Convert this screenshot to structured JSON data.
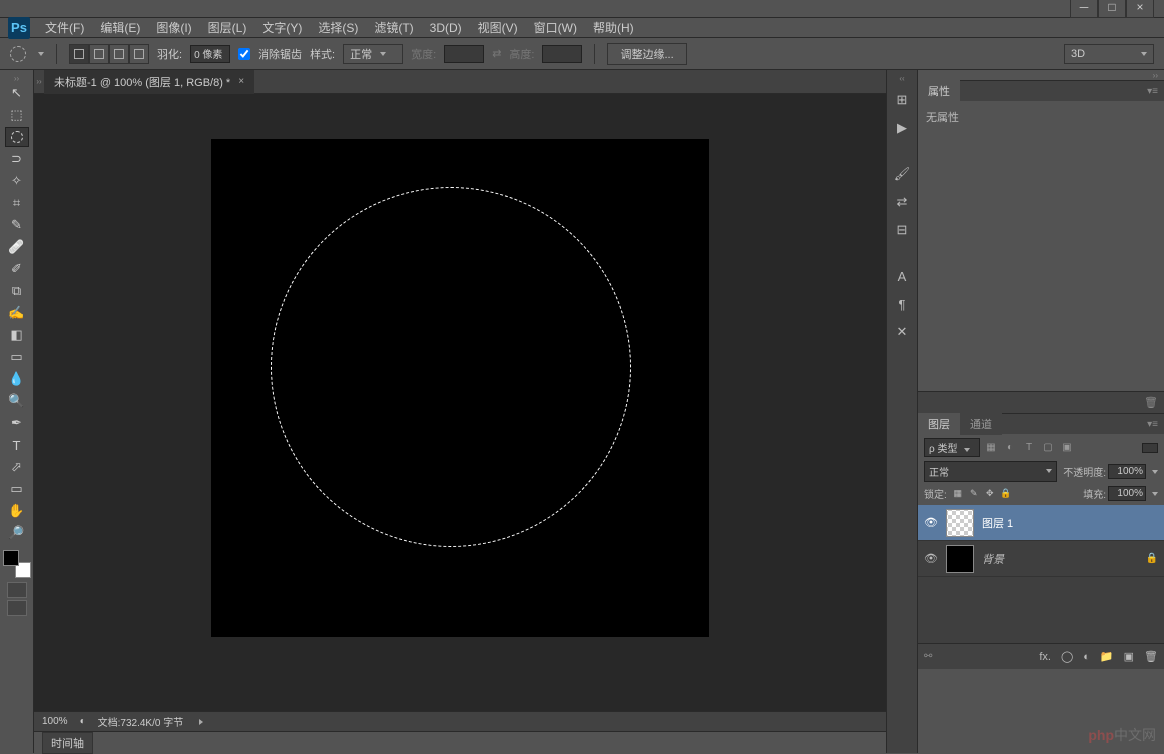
{
  "app": {
    "name": "Ps"
  },
  "window": {
    "min": "－",
    "max": "□",
    "close": "×"
  },
  "menu": [
    "文件(F)",
    "编辑(E)",
    "图像(I)",
    "图层(L)",
    "文字(Y)",
    "选择(S)",
    "滤镜(T)",
    "3D(D)",
    "视图(V)",
    "窗口(W)",
    "帮助(H)"
  ],
  "options": {
    "feather_label": "羽化:",
    "feather_value": "0 像素",
    "antialias_label": "消除锯齿",
    "style_label": "样式:",
    "style_value": "正常",
    "width_label": "宽度:",
    "height_label": "高度:",
    "refine_edge": "调整边缘...",
    "workspace": "3D"
  },
  "document": {
    "tab_title": "未标题-1 @ 100% (图层 1, RGB/8) *"
  },
  "status": {
    "zoom": "100%",
    "doc_info": "文档:732.4K/0 字节"
  },
  "timeline": {
    "label": "时间轴"
  },
  "panels": {
    "properties": {
      "title": "属性",
      "content": "无属性"
    },
    "layers": {
      "tabs": [
        "图层",
        "通道"
      ],
      "filter_kind": "ρ 类型",
      "blend_mode": "正常",
      "opacity_label": "不透明度:",
      "opacity_value": "100%",
      "lock_label": "锁定:",
      "fill_label": "填充:",
      "fill_value": "100%",
      "items": [
        {
          "name": "图层 1",
          "locked": false,
          "transparent": true
        },
        {
          "name": "背景",
          "locked": true,
          "transparent": false
        }
      ]
    }
  },
  "tools": [
    "↖",
    "⬚",
    "○",
    "✎",
    "⌗",
    "✂",
    "✐",
    "↙",
    "✍",
    "⧉",
    "◧",
    "▭",
    "●",
    "🔍",
    "✒",
    "T",
    "⬀",
    "⬡",
    "✋",
    "🔎"
  ],
  "dock_icons": [
    "⊞",
    "▶",
    "🖌",
    "⇄",
    "⊟",
    "A",
    "¶",
    "✕"
  ],
  "watermark": {
    "left": "php",
    "right": "中文网"
  }
}
